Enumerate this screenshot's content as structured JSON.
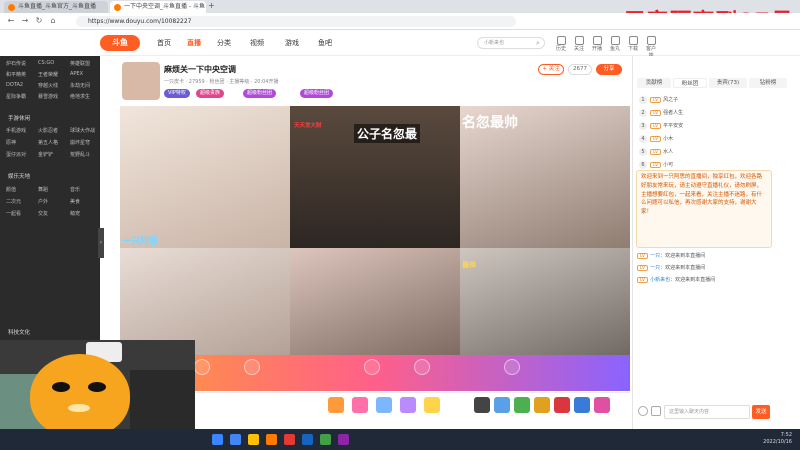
{
  "overlay_text": "居家隔离到17号",
  "browser": {
    "tabs": [
      {
        "label": "斗鱼直播_斗鱼官方_斗鱼直播"
      },
      {
        "label": "一下中央空调_斗鱼直播 - 斗鱼"
      }
    ],
    "url": "https://www.douyu.com/10082227"
  },
  "site": {
    "logo": "斗鱼",
    "nav": [
      "首页",
      "直播",
      "分类",
      "视频",
      "游戏",
      "鱼吧"
    ],
    "active_nav": "直播",
    "search_placeholder": "小新来也",
    "header_icons": [
      "历史",
      "关注",
      "开播",
      "鱼丸",
      "下载",
      "客户端"
    ]
  },
  "sidebar": {
    "sections": [
      {
        "title": "",
        "rows": [
          [
            "炉石传说",
            "CS:GO",
            "英雄联盟"
          ],
          [
            "和平精英",
            "王者荣耀",
            "APEX"
          ],
          [
            "DOTA2",
            "穿越火线",
            "永劫无间"
          ],
          [
            "星际争霸",
            "暴雪游戏",
            "绝地求生"
          ]
        ]
      },
      {
        "title": "手游休闲",
        "rows": [
          [
            "手机游戏",
            "火影忍者",
            "球球大作战"
          ],
          [
            "原神",
            "第五人格",
            "崩坏星穹"
          ],
          [
            "蛋仔派对",
            "金铲铲",
            "荒野乱斗"
          ]
        ]
      },
      {
        "title": "娱乐天地",
        "rows": [
          [
            "颜值",
            "舞蹈",
            "音乐"
          ],
          [
            "二次元",
            "户外",
            "美食"
          ],
          [
            "一起看",
            "交友",
            "萌宠"
          ]
        ]
      },
      {
        "title": "科技文化",
        "rows": []
      }
    ]
  },
  "room": {
    "title": "麻烦关一下中央空调",
    "meta": [
      "一只皮卡",
      "27959",
      "粉丝团",
      "主播等级",
      "20:04开播"
    ],
    "badges": [
      "VIP特权",
      "超级贵族",
      "超级粉丝团",
      "超级粉丝团"
    ],
    "follow_label": "+ 关注",
    "follow_count": "2677",
    "share_label": "分享"
  },
  "stream_captions": [
    "公子名忽最",
    "名忽最帅",
    "一只阿思",
    "天天发大财",
    "最帅"
  ],
  "panel": {
    "tabs": [
      "贡献榜",
      "粉丝团",
      "贵宾(73)",
      "钻粉榜"
    ],
    "ranks": [
      "风之子",
      "强者人生",
      "平平安安",
      "小木",
      "水人",
      "小可"
    ],
    "notice": "欢迎来到一只阿思的直播间，独享红包，欢迎各路好朋友常来玩，请主动遵守直播礼仪，请勿刷屏，主播想要红包，一起来看，关注主播不迷路，有什么问题可以私信，再次感谢大家的支持，谢谢大家！",
    "chat": [
      {
        "user": "一只",
        "text": "欢迎来到本直播间"
      },
      {
        "user": "一只",
        "text": "欢迎来到本直播间"
      },
      {
        "user": "小新来也",
        "text": "欢迎来到本直播间"
      }
    ],
    "input_placeholder": "这里输入聊天内容",
    "send_label": "发送"
  },
  "taskbar": {
    "time": "7:52",
    "date": "2022/10/16"
  }
}
